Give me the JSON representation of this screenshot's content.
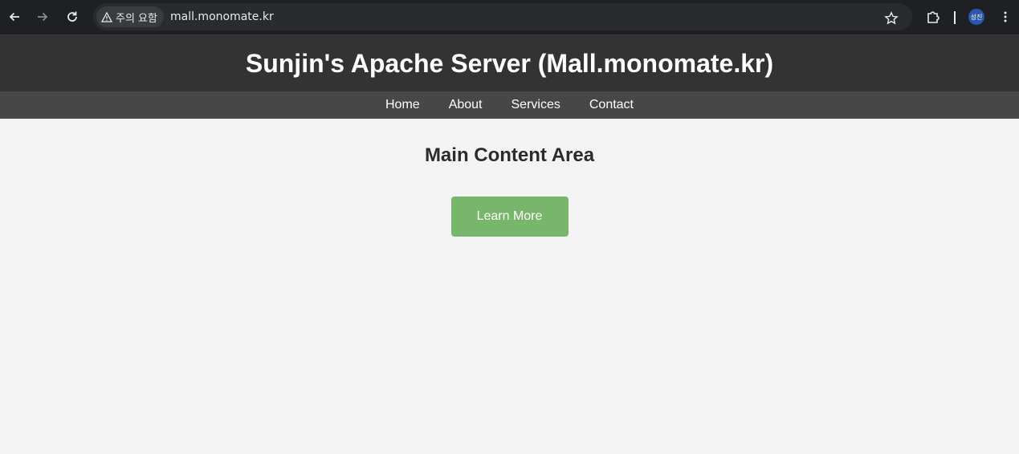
{
  "browser": {
    "security_label": "주의 요함",
    "url": "mall.monomate.kr",
    "avatar_text": "성진"
  },
  "site": {
    "title": "Sunjin's Apache Server (Mall.monomate.kr)",
    "nav": [
      "Home",
      "About",
      "Services",
      "Contact"
    ]
  },
  "main": {
    "heading": "Main Content Area",
    "button_label": "Learn More"
  },
  "colors": {
    "header_bg": "#333333",
    "nav_bg": "#474747",
    "page_bg": "#f3f3f3",
    "button_bg": "#78b66b"
  }
}
